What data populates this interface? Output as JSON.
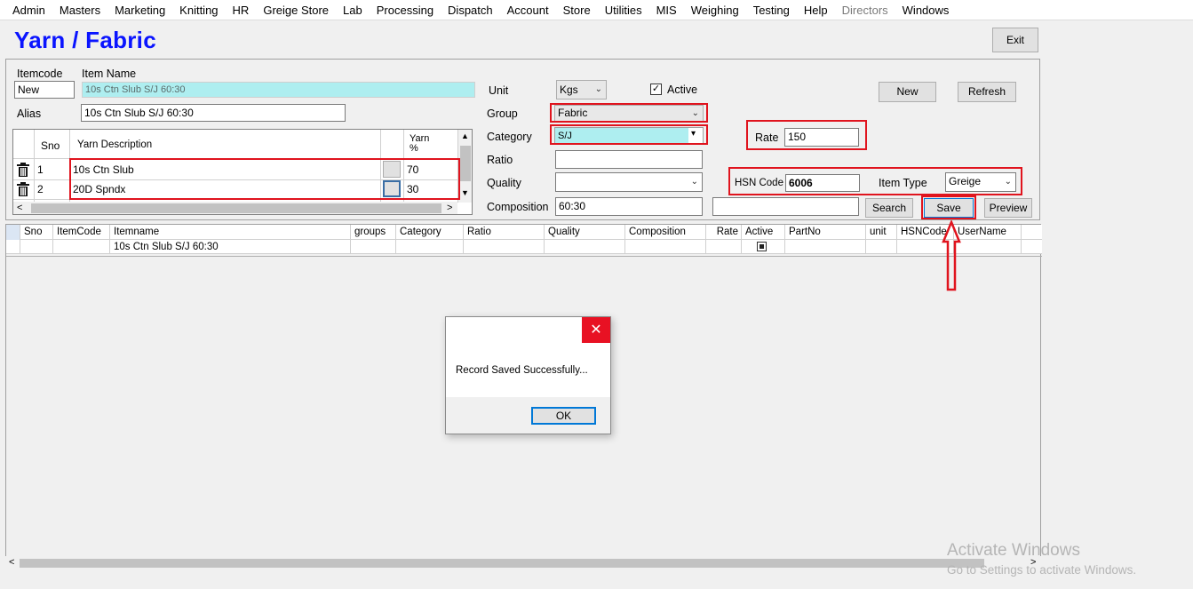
{
  "menu": [
    "Admin",
    "Masters",
    "Marketing",
    "Knitting",
    "HR",
    "Greige Store",
    "Lab",
    "Processing",
    "Dispatch",
    "Account",
    "Store",
    "Utilities",
    "MIS",
    "Weighing",
    "Testing",
    "Help",
    "Directors",
    "Windows"
  ],
  "menu_disabled_index": 16,
  "page_title": "Yarn / Fabric",
  "buttons": {
    "exit": "Exit",
    "new": "New",
    "refresh": "Refresh",
    "search": "Search",
    "save": "Save",
    "preview": "Preview"
  },
  "form": {
    "itemcode_label": "Itemcode",
    "itemcode_value": "New",
    "itemname_label": "Item Name",
    "itemname_value": "10s Ctn Slub S/J  60:30",
    "alias_label": "Alias",
    "alias_value": "10s Ctn Slub S/J  60:30",
    "unit_label": "Unit",
    "unit_value": "Kgs",
    "active_label": "Active",
    "active_checked": true,
    "group_label": "Group",
    "group_value": "Fabric",
    "category_label": "Category",
    "category_value": "S/J",
    "ratio_label": "Ratio",
    "ratio_value": "",
    "quality_label": "Quality",
    "quality_value": "",
    "composition_label": "Composition",
    "composition_value": "60:30",
    "rate_label": "Rate",
    "rate_value": "150",
    "hsn_label": "HSN Code",
    "hsn_value": "6006",
    "itemtype_label": "Item Type",
    "itemtype_value": "Greige",
    "search_value": ""
  },
  "yarn_grid": {
    "headers": [
      "Sno",
      "Yarn Description",
      "Yarn\n%"
    ],
    "rows": [
      {
        "sno": "1",
        "desc": "10s Ctn Slub",
        "pct": "70"
      },
      {
        "sno": "2",
        "desc": "20D Spndx",
        "pct": "30"
      }
    ]
  },
  "main_grid": {
    "headers": [
      "Sno",
      "ItemCode",
      "Itemname",
      "groups",
      "Category",
      "Ratio",
      "Quality",
      "Composition",
      "Rate",
      "Active",
      "PartNo",
      "unit",
      "HSNCode",
      "UserName"
    ],
    "row": [
      "",
      "",
      "10s Ctn Slub S/J  60:30",
      "",
      "",
      "",
      "",
      "",
      "",
      "",
      "",
      "",
      "",
      ""
    ]
  },
  "dialog": {
    "message": "Record Saved Successfully...",
    "ok": "OK",
    "close_icon": "close-icon"
  },
  "watermark": {
    "line1": "Activate Windows",
    "line2": "Go to Settings to activate Windows."
  },
  "colors": {
    "title": "#0a14ff",
    "highlight": "#e0141e",
    "cyan_field": "#aeeef0"
  }
}
